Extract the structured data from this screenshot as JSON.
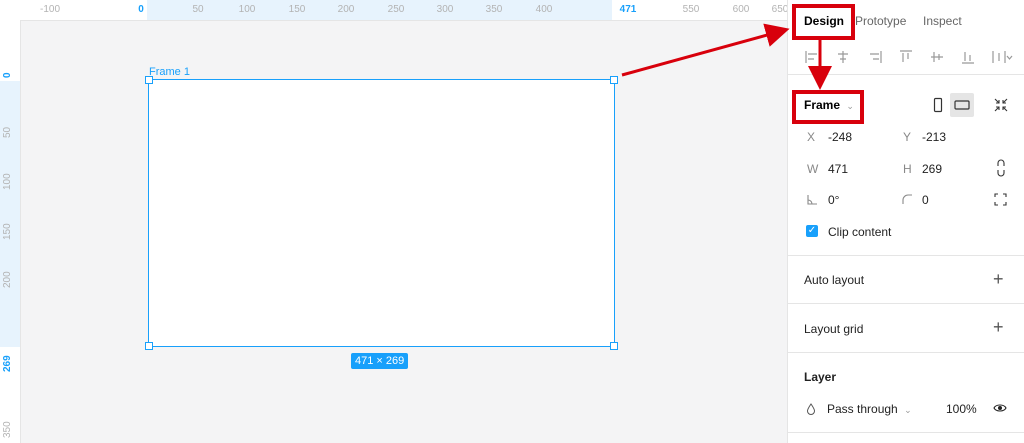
{
  "ruler": {
    "top_ticks": [
      "-100",
      "0",
      "50",
      "100",
      "150",
      "200",
      "250",
      "300",
      "350",
      "400",
      "471",
      "550",
      "600",
      "650"
    ],
    "left_ticks": [
      "0",
      "50",
      "100",
      "150",
      "200",
      "269",
      "350"
    ]
  },
  "canvas": {
    "frame_label": "Frame 1",
    "size_badge": "471 × 269"
  },
  "panel": {
    "tabs": {
      "design": "Design",
      "prototype": "Prototype",
      "inspect": "Inspect"
    },
    "frame_select": "Frame",
    "props": {
      "x_label": "X",
      "x_value": "-248",
      "y_label": "Y",
      "y_value": "-213",
      "w_label": "W",
      "w_value": "471",
      "h_label": "H",
      "h_value": "269",
      "rotation": "0°",
      "radius": "0"
    },
    "clip_content": "Clip content",
    "auto_layout": "Auto layout",
    "layout_grid": "Layout grid",
    "layer": {
      "title": "Layer",
      "blend_mode": "Pass through",
      "opacity": "100%"
    }
  },
  "colors": {
    "accent": "#18a0fb",
    "annotation": "#d8000c"
  }
}
